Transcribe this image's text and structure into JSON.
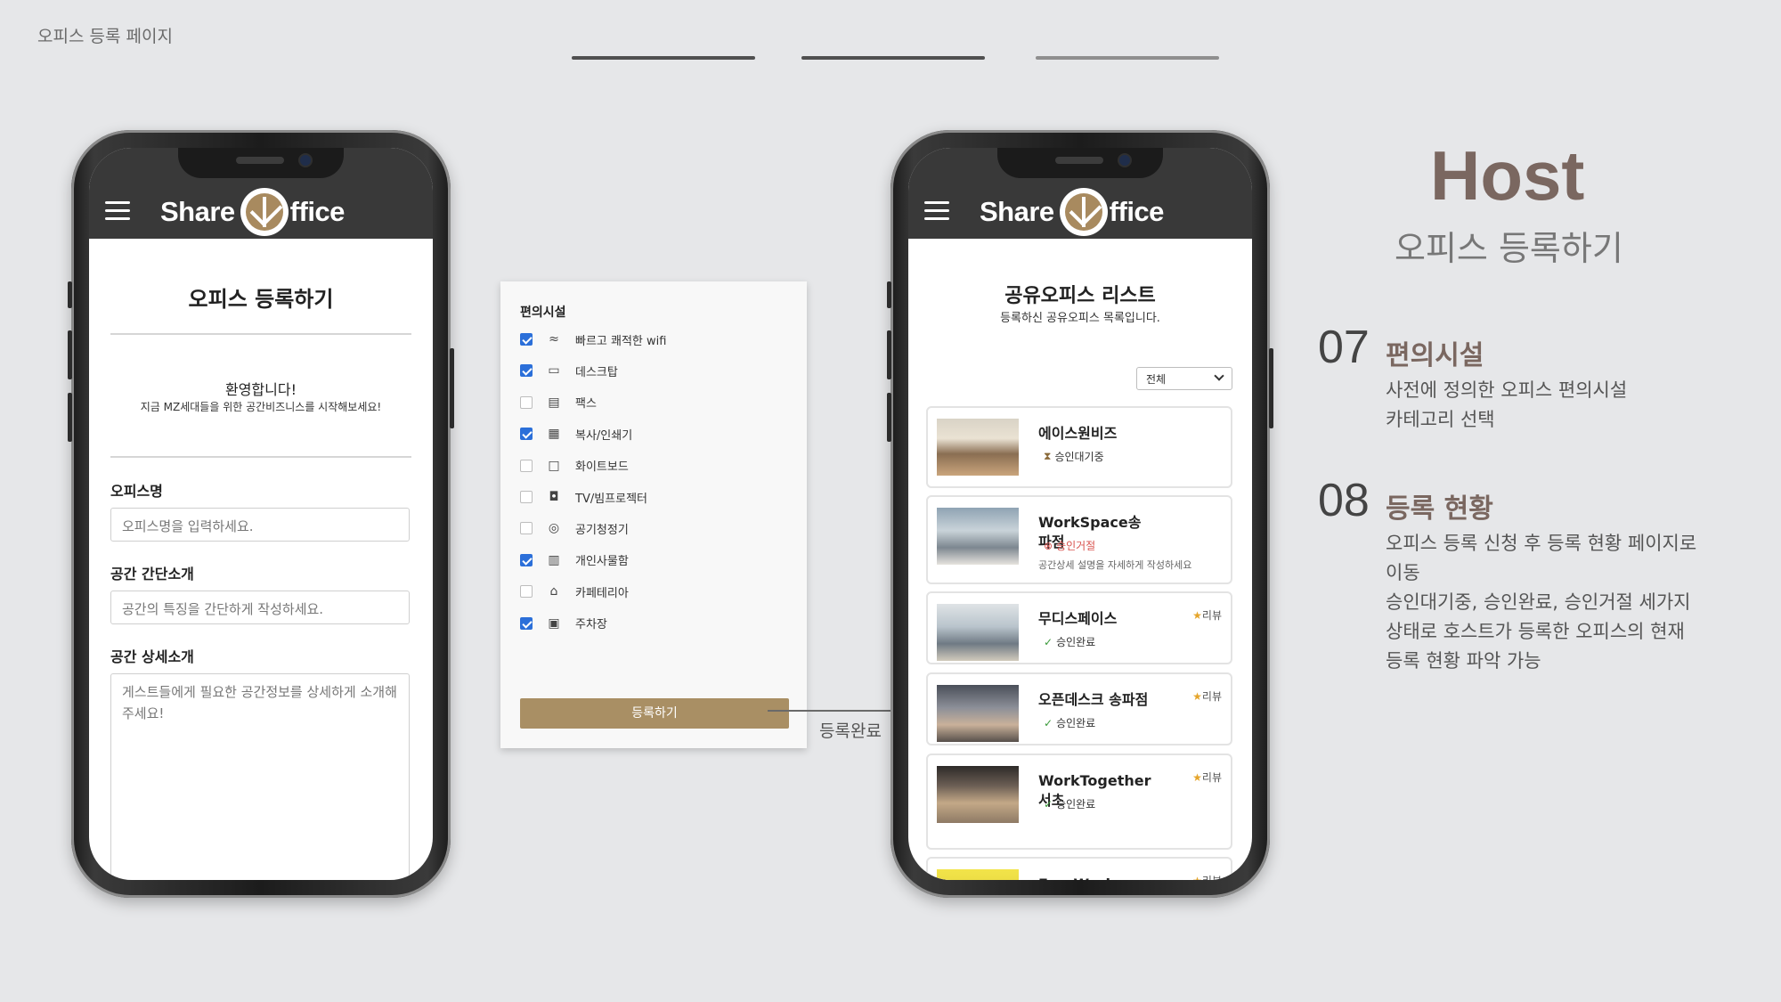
{
  "page_label": "오피스 등록 페이지",
  "colors": {
    "accent": "#a98f64",
    "title_brown": "#7a6760",
    "checkbox_blue": "#2b6fd9",
    "progress_dark": "#505050",
    "progress_light": "#8f8f8f"
  },
  "logo": {
    "left": "Share",
    "right": "ffice"
  },
  "register_phone": {
    "title": "오피스 등록하기",
    "welcome": "환영합니다!",
    "welcome_sub": "지금 MZ세대들을 위한 공간비즈니스를 시작해보세요!",
    "fields": [
      {
        "label": "오피스명",
        "placeholder": "오피스명을 입력하세요."
      },
      {
        "label": "공간 간단소개",
        "placeholder": "공간의 특징을 간단하게 작성하세요."
      },
      {
        "label": "공간 상세소개",
        "placeholder": "게스트들에게 필요한 공간정보를 상세하게 소개해주세요!"
      }
    ]
  },
  "amenities_card": {
    "title": "편의시설",
    "items": [
      {
        "label": "빠르고 쾌적한 wifi",
        "checked": true,
        "icon": "wifi-icon"
      },
      {
        "label": "데스크탑",
        "checked": true,
        "icon": "desktop-icon"
      },
      {
        "label": "팩스",
        "checked": false,
        "icon": "fax-icon"
      },
      {
        "label": "복사/인쇄기",
        "checked": true,
        "icon": "printer-icon"
      },
      {
        "label": "화이트보드",
        "checked": false,
        "icon": "whiteboard-icon"
      },
      {
        "label": "TV/빔프로젝터",
        "checked": false,
        "icon": "projector-icon"
      },
      {
        "label": "공기청정기",
        "checked": false,
        "icon": "air-purifier-icon"
      },
      {
        "label": "개인사물함",
        "checked": true,
        "icon": "locker-icon"
      },
      {
        "label": "카페테리아",
        "checked": false,
        "icon": "cafeteria-icon"
      },
      {
        "label": "주차장",
        "checked": true,
        "icon": "parking-icon"
      }
    ],
    "button": "등록하기"
  },
  "connector_label": "등록완료",
  "list_phone": {
    "title": "공유오피스 리스트",
    "subtitle": "등록하신 공유오피스 목록입니다.",
    "filter": "전체",
    "offices": [
      {
        "name": "에이스원비즈",
        "status": "승인대기중",
        "status_icon": "hourglass-icon",
        "review": ""
      },
      {
        "name": "WorkSpace송파점",
        "status": "승인거절",
        "status_icon": "reject-icon",
        "note": "공간상세 설명을 자세하게 작성하세요",
        "review": ""
      },
      {
        "name": "무디스페이스",
        "status": "승인완료",
        "status_icon": "check-icon",
        "review": "리뷰"
      },
      {
        "name": "오픈데스크 송파점",
        "status": "승인완료",
        "status_icon": "check-icon",
        "review": "리뷰"
      },
      {
        "name": "WorkTogether서초",
        "status": "승인완료",
        "status_icon": "check-icon",
        "review": "리뷰"
      },
      {
        "name": "FreeWork",
        "status": "",
        "status_icon": "",
        "review": "리뷰"
      }
    ]
  },
  "description": {
    "host": "Host",
    "host_sub": "오피스 등록하기",
    "steps": [
      {
        "num": "07",
        "title": "편의시설",
        "desc": [
          "사전에 정의한 오피스 편의시설",
          "카테고리 선택"
        ]
      },
      {
        "num": "08",
        "title": "등록 현황",
        "desc": [
          "오피스 등록 신청 후 등록 현황 페이지로",
          "이동",
          "승인대기중, 승인완료, 승인거절 세가지",
          "상태로 호스트가 등록한 오피스의 현재",
          "등록 현황 파악 가능"
        ]
      }
    ]
  }
}
